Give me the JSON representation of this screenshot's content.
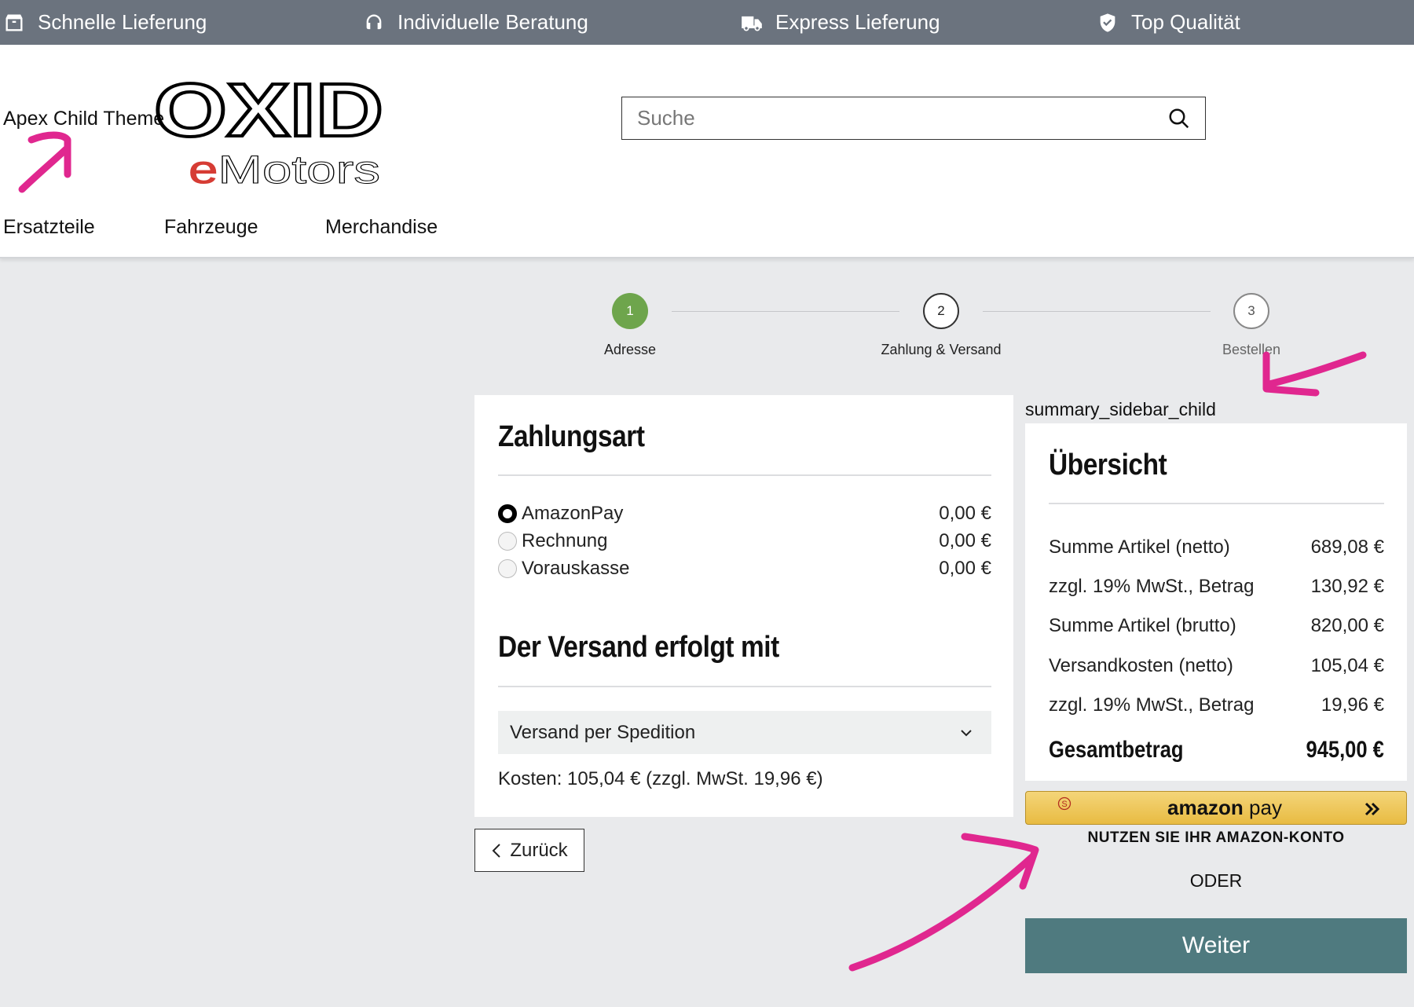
{
  "usp_bar": {
    "items": [
      {
        "icon": "package-icon",
        "label": "Schnelle Lieferung"
      },
      {
        "icon": "headset-icon",
        "label": "Individuelle Beratung"
      },
      {
        "icon": "truck-icon",
        "label": "Express Lieferung"
      },
      {
        "icon": "shield-check-icon",
        "label": "Top Qualität"
      }
    ]
  },
  "header": {
    "theme_name": "Apex Child Theme",
    "logo_text_top": "OXID",
    "logo_text_bottom_e": "e",
    "logo_text_bottom_rest": "Motors",
    "search": {
      "placeholder": "Suche"
    },
    "nav": [
      "Ersatzteile",
      "Fahrzeuge",
      "Merchandise"
    ]
  },
  "steps": [
    {
      "number": "1",
      "label": "Adresse",
      "state": "done"
    },
    {
      "number": "2",
      "label": "Zahlung & Versand",
      "state": "current"
    },
    {
      "number": "3",
      "label": "Bestellen",
      "state": "upcoming"
    }
  ],
  "payment": {
    "title": "Zahlungsart",
    "methods": [
      {
        "label": "AmazonPay",
        "price": "0,00 €",
        "checked": true
      },
      {
        "label": "Rechnung",
        "price": "0,00 €",
        "checked": false
      },
      {
        "label": "Vorauskasse",
        "price": "0,00 €",
        "checked": false
      }
    ],
    "shipping_title": "Der Versand erfolgt mit",
    "shipping_selected": "Versand per Spedition",
    "shipping_cost": "Kosten: 105,04 € (zzgl. MwSt. 19,96 €)"
  },
  "back_button": {
    "label": "Zurück"
  },
  "summary": {
    "sidebar_label": "summary_sidebar_child",
    "title": "Übersicht",
    "rows": [
      {
        "label": "Summe Artikel (netto)",
        "value": "689,08 €"
      },
      {
        "label": "zzgl. 19% MwSt., Betrag",
        "value": "130,92 €"
      },
      {
        "label": "Summe Artikel (brutto)",
        "value": "820,00 €"
      },
      {
        "label": "Versandkosten (netto)",
        "value": "105,04 €"
      },
      {
        "label": "zzgl. 19% MwSt., Betrag",
        "value": "19,96 €"
      }
    ],
    "total_label": "Gesamtbetrag",
    "total_value": "945,00 €",
    "amazon_pay": {
      "brand": "amazon",
      "suffix": " pay",
      "subtitle": "NUTZEN SIE IHR AMAZON-KONTO"
    },
    "or_text": "ODER",
    "next_button": "Weiter"
  },
  "colors": {
    "usp_bar": "#6b737e",
    "step_done": "#6ea54c",
    "weiter": "#4f7a7f",
    "amazon": "#f0c85a",
    "annotation": "#e0278f"
  }
}
